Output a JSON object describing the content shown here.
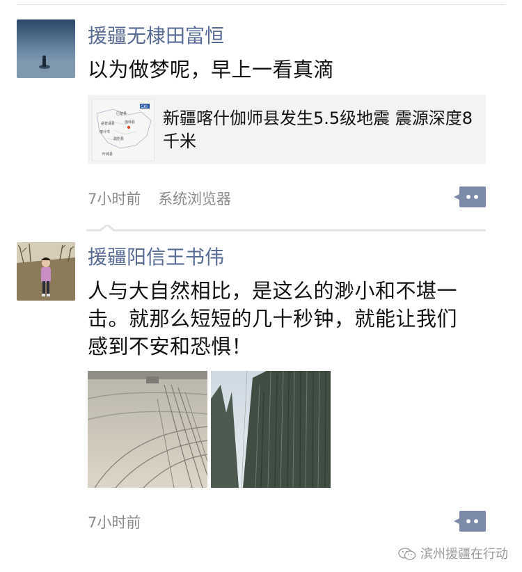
{
  "posts": [
    {
      "author": "援疆无棣田富恒",
      "text": "以为做梦呢，早上一看真滴",
      "link_title": "新疆喀什伽师县发生5.5级地震 震源深度8千米",
      "map_labels": [
        "CKI",
        "巴楚县",
        "岳普湖县",
        "伽师县",
        "喀什市",
        "疏附县",
        "叶城县"
      ],
      "time": "7小时前",
      "source": "系统浏览器",
      "comment_icon": "comment-dots-icon"
    },
    {
      "author": "援疆阳信王书伟",
      "text": "人与大自然相比，是这么的渺小和不堪一击。就那么短短的几十秒钟，就能让我们感到不安和恐惧！",
      "time": "7小时前",
      "comment_icon": "comment-dots-icon"
    }
  ],
  "watermark": "滨州援疆在行动",
  "colors": {
    "author": "#576b95",
    "meta": "#8b8b8b",
    "card_bg": "#f3f3f5",
    "comment_btn": "#7a8aa8"
  }
}
